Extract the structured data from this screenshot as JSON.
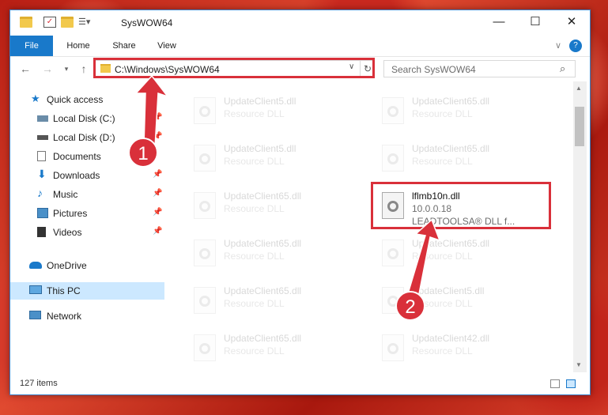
{
  "window": {
    "title": "SysWOW64"
  },
  "ribbon": {
    "tabs": [
      "File",
      "Home",
      "Share",
      "View"
    ]
  },
  "controls": {
    "minimize": "—",
    "maximize": "☐",
    "close": "✕",
    "expand": "∨",
    "help": "?"
  },
  "nav": {
    "address": "C:\\Windows\\SysWOW64",
    "search_placeholder": "Search SysWOW64"
  },
  "sidebar": {
    "items": [
      {
        "label": "Quick access"
      },
      {
        "label": "Local Disk (C:)"
      },
      {
        "label": "Local Disk (D:)"
      },
      {
        "label": "Documents"
      },
      {
        "label": "Downloads"
      },
      {
        "label": "Music"
      },
      {
        "label": "Pictures"
      },
      {
        "label": "Videos"
      },
      {
        "label": "OneDrive"
      },
      {
        "label": "This PC"
      },
      {
        "label": "Network"
      }
    ]
  },
  "files": {
    "left": [
      {
        "name": "UpdateClient5.dll",
        "desc": "Resource DLL"
      },
      {
        "name": "UpdateClient5.dll",
        "desc": "Resource DLL"
      },
      {
        "name": "UpdateClient65.dll",
        "desc": "Resource DLL"
      },
      {
        "name": "UpdateClient65.dll",
        "desc": "Resource DLL"
      },
      {
        "name": "UpdateClient65.dll",
        "desc": "Resource DLL"
      },
      {
        "name": "UpdateClient65.dll",
        "desc": "Resource DLL"
      }
    ],
    "right": [
      {
        "name": "UpdateClient65.dll",
        "desc": "Resource DLL"
      },
      {
        "name": "UpdateClient65.dll",
        "desc": "Resource DLL"
      },
      {
        "name": "lflmb10n.dll",
        "desc": "10.0.0.18",
        "desc2": "LEADTOOLSA® DLL f..."
      },
      {
        "name": "UpdateClient65.dll",
        "desc": "Resource DLL"
      },
      {
        "name": "UpdateClient5.dll",
        "desc": "Resource DLL"
      },
      {
        "name": "UpdateClient42.dll",
        "desc": "Resource DLL"
      }
    ]
  },
  "status": {
    "count": "127 items"
  },
  "annotations": {
    "step1": "1",
    "step2": "2"
  },
  "colors": {
    "accent": "#1979ca",
    "highlight": "#d9303a",
    "selection": "#cce8ff"
  }
}
